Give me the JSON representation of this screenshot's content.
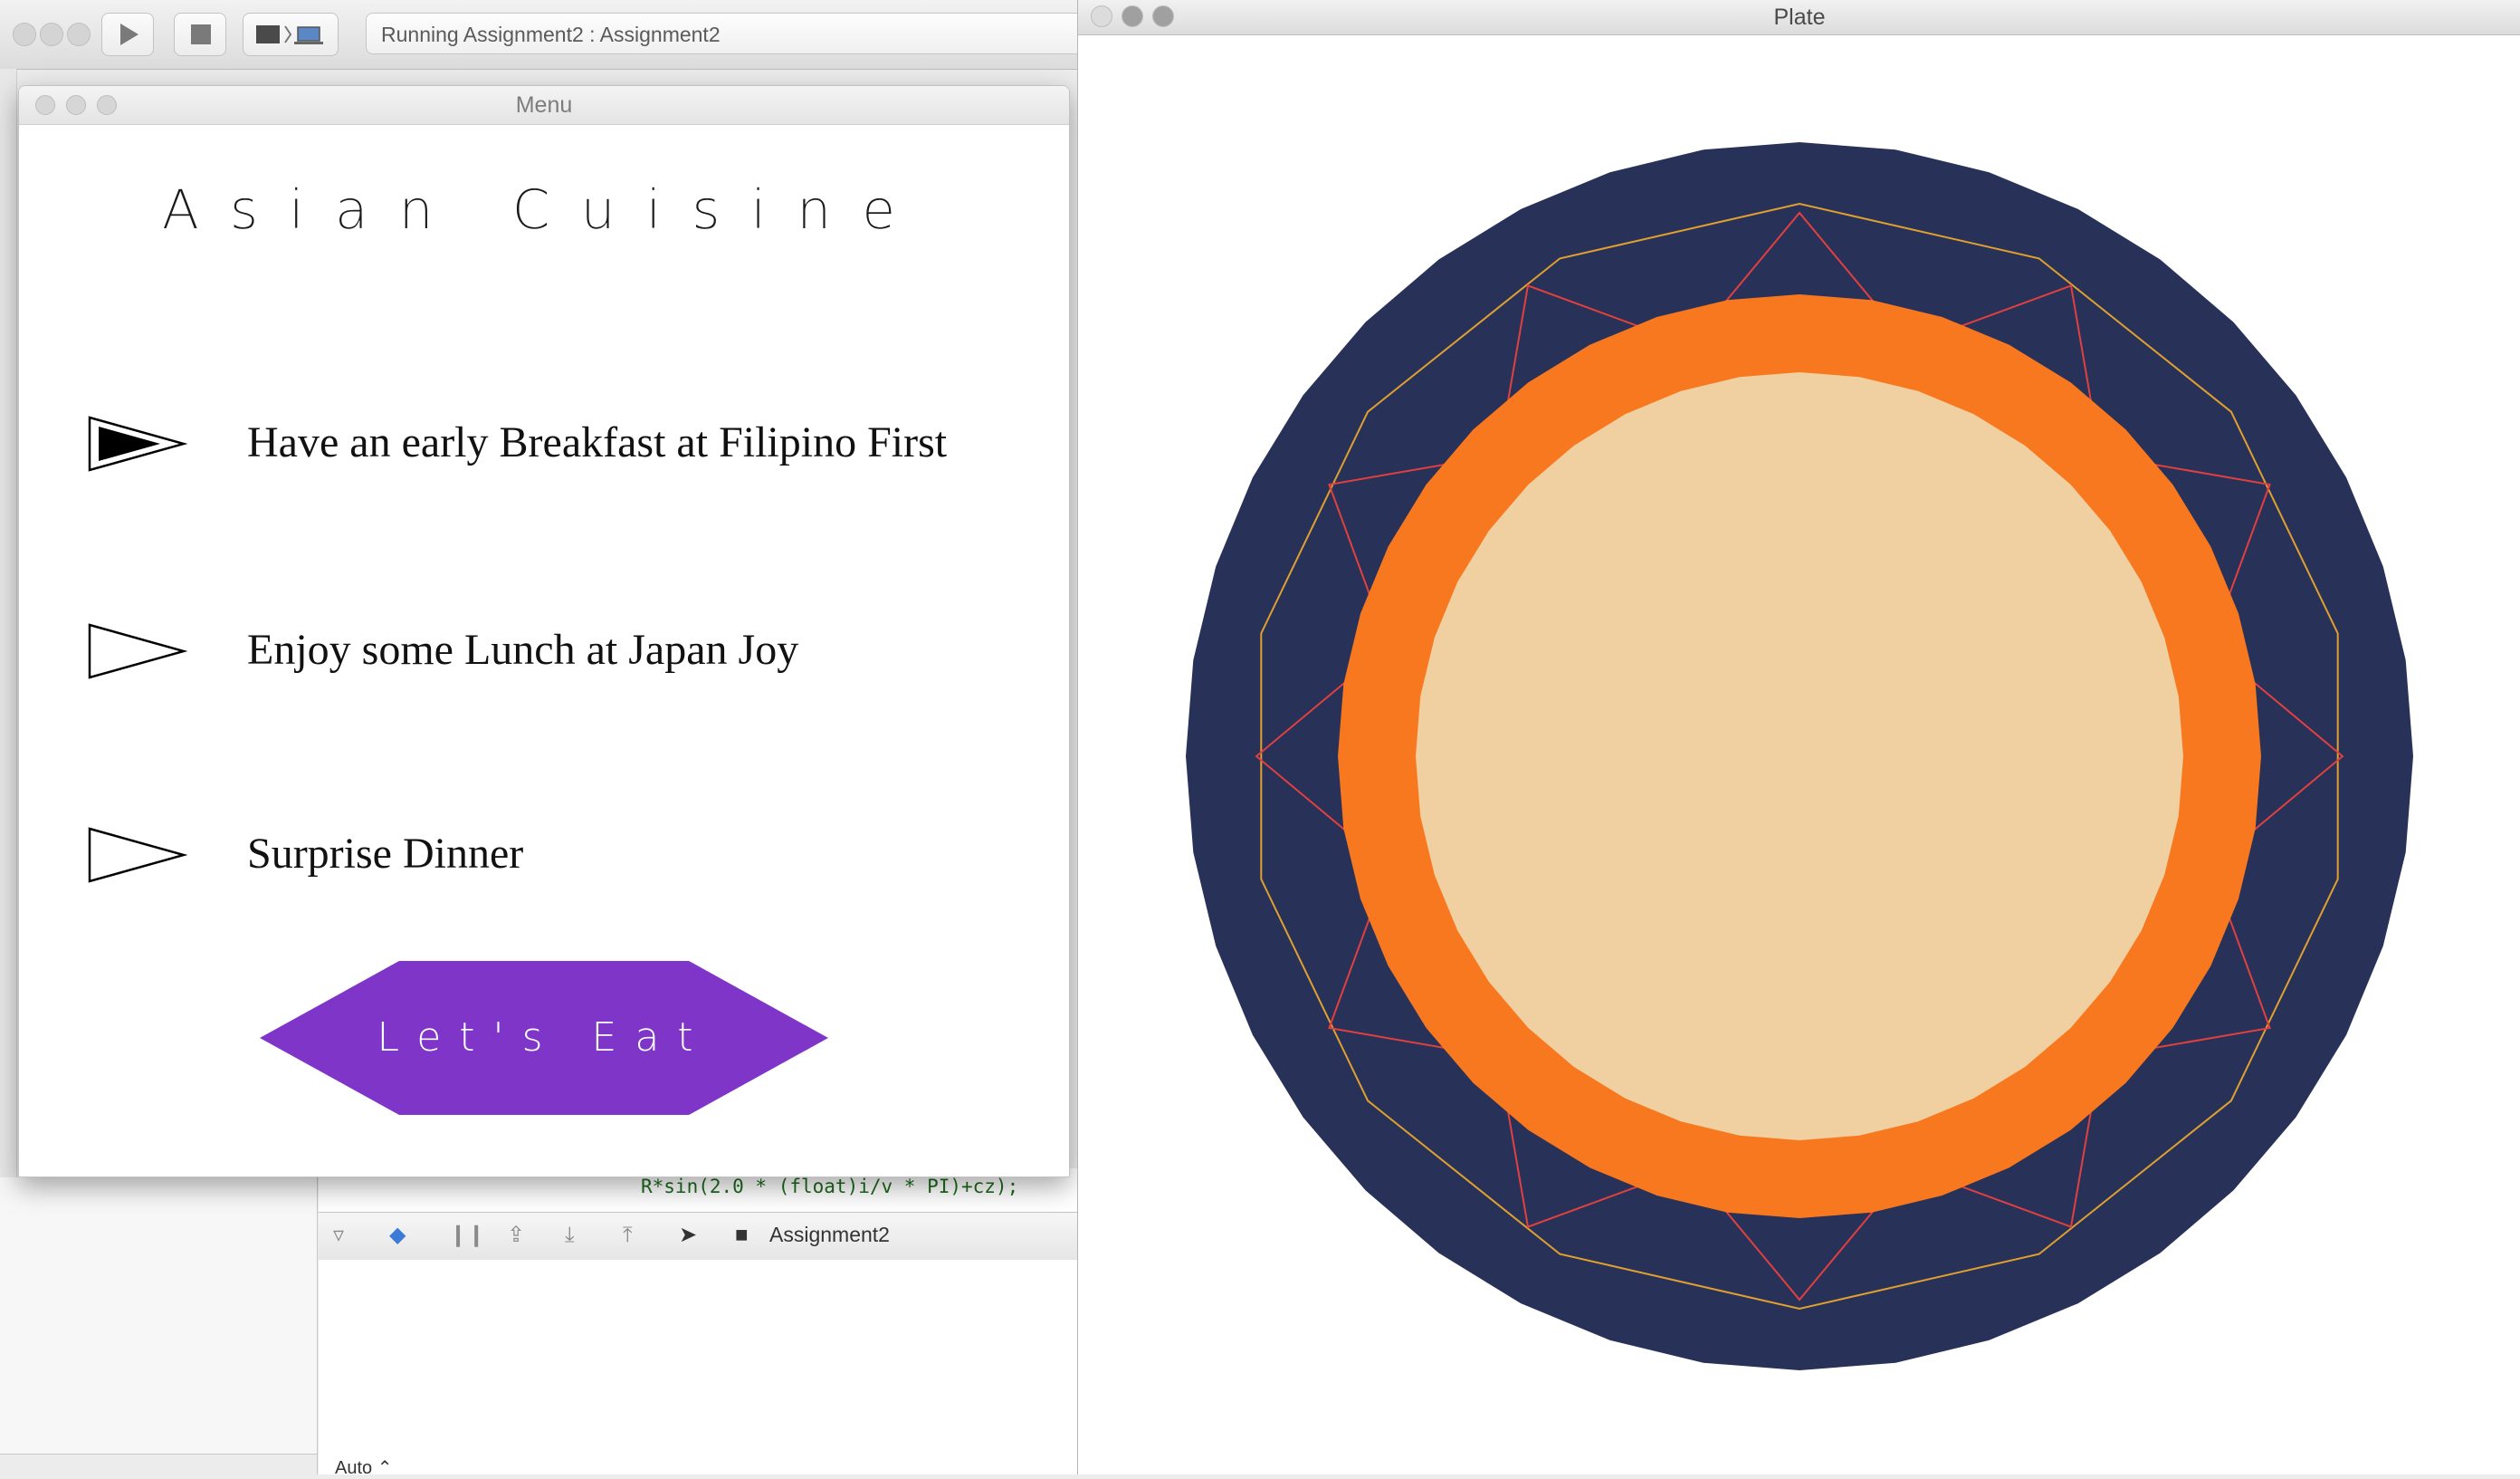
{
  "xcode": {
    "status_text": "Running Assignment2 : Assignment2",
    "code_line": "R*sin(2.0 * (float)i/v * PI)+cz);",
    "debug_target": "Assignment2",
    "console_mode": "Auto ⌃"
  },
  "menu_window": {
    "title": "Menu",
    "heading": "Asian Cuisine",
    "options": [
      {
        "label": "Have an early Breakfast at Filipino First",
        "selected": true
      },
      {
        "label": "Enjoy some Lunch at Japan Joy",
        "selected": false
      },
      {
        "label": "Surprise Dinner",
        "selected": false
      }
    ],
    "action_button": {
      "label": "Let's Eat",
      "color": "#7f35c8"
    }
  },
  "plate_window": {
    "title": "Plate",
    "colors": {
      "rim": "#283158",
      "band": "#f87820",
      "center": "#f0cfa1",
      "inner_line": "#e0a030",
      "spikes": "#e04040"
    }
  }
}
